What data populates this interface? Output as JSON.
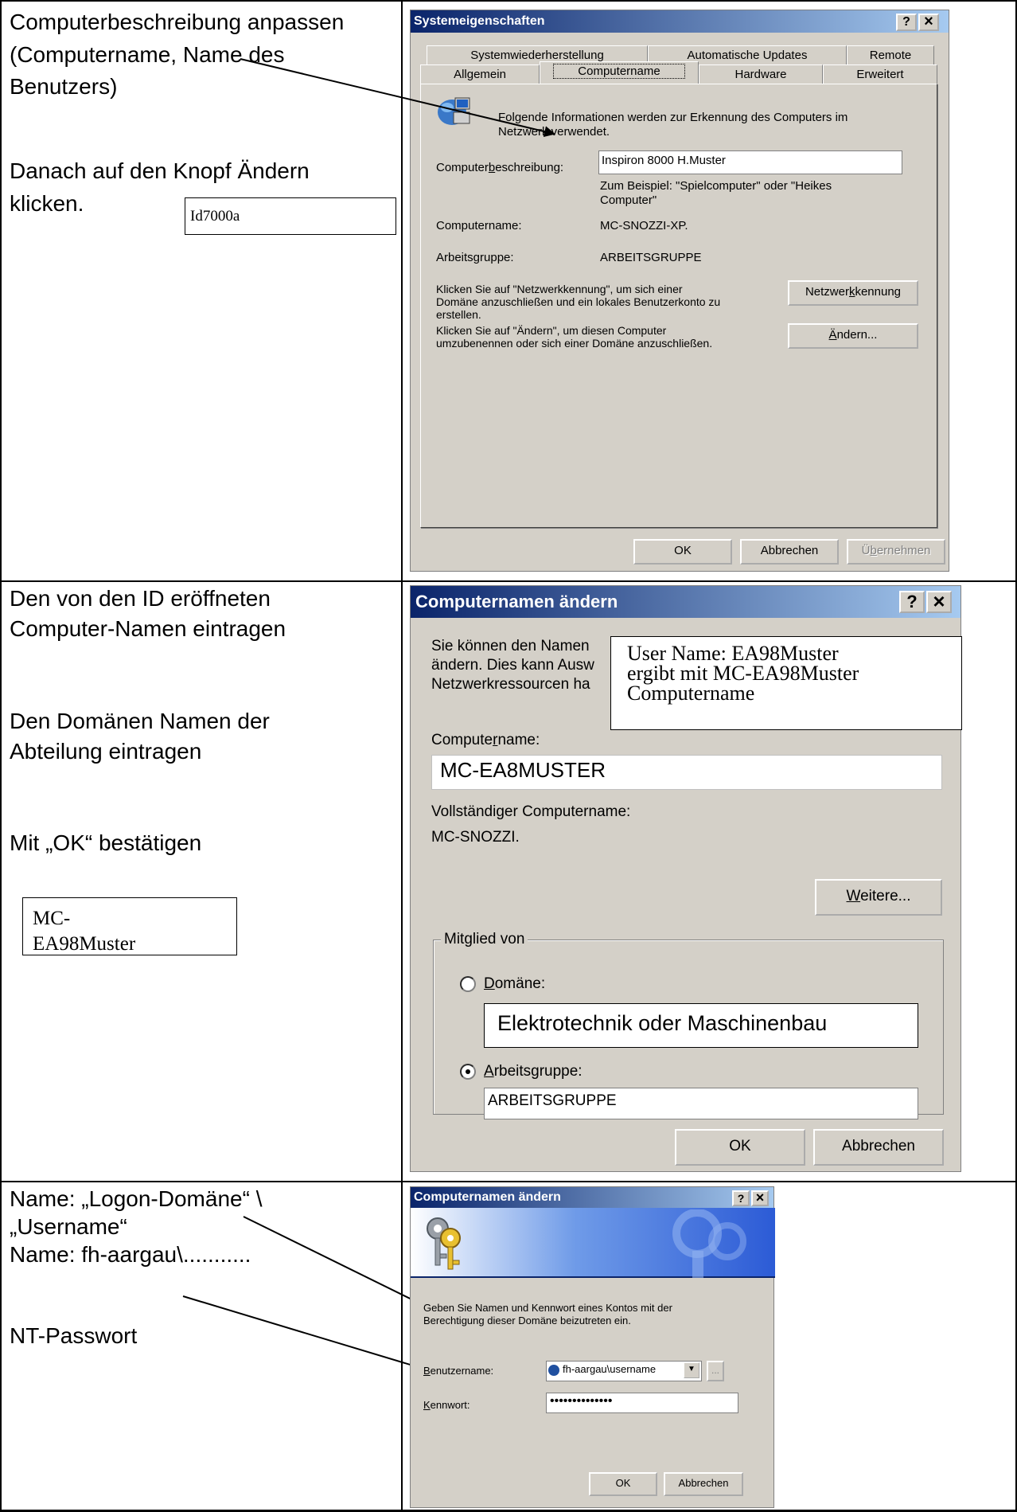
{
  "left_column": {
    "row1": {
      "line1": "Computerbeschreibung anpassen",
      "line2": "(Computername, Name des",
      "line3": "Benutzers)",
      "line4": "Danach auf den Knopf Ändern",
      "line5": "klicken.",
      "box_text": "Id7000a"
    },
    "row2": {
      "line1": "Den von den ID eröffneten",
      "line2": "Computer-Namen eintragen",
      "line3": "Den Domänen Namen der",
      "line4": "Abteilung eintragen",
      "line5": "Mit „OK“ bestätigen",
      "box_line1": "MC-",
      "box_line2": "EA98Muster"
    },
    "row3": {
      "line1": "Name: „Logon-Domäne“ \\",
      "line2": "„Username“",
      "line3": "Name: fh-aargau\\...........",
      "line4": "NT-Passwort"
    }
  },
  "dialog1": {
    "title": "Systemeigenschaften",
    "help": "?",
    "close": "×",
    "tabs_back": [
      "Systemwiederherstellung",
      "Automatische Updates",
      "Remote"
    ],
    "tabs_front": [
      "Allgemein",
      "Computername",
      "Hardware",
      "Erweitert"
    ],
    "info_line1": "Folgende Informationen werden zur Erkennung des Computers im",
    "info_line2": "Netzwerk verwendet.",
    "desc_label": "Computerbeschreibung:",
    "desc_value": "Inspiron 8000 H.Muster",
    "example_line1": "Zum Beispiel: \"Spielcomputer\" oder \"Heikes",
    "example_line2": "Computer\"",
    "name_label": "Computername:",
    "name_value": "MC-SNOZZI-XP.",
    "group_label": "Arbeitsgruppe:",
    "group_value": "ARBEITSGRUPPE",
    "netid_text1": "Klicken Sie auf \"Netzwerkkennung\", um sich einer",
    "netid_text2": "Domäne anzuschließen und ein lokales Benutzerkonto zu",
    "netid_text3": "erstellen.",
    "netid_button": "Netzwerkkennung",
    "change_text1": "Klicken Sie auf \"Ändern\", um diesen Computer",
    "change_text2": "umzubenennen oder sich einer Domäne anzuschließen.",
    "change_button": "Ändern...",
    "ok": "OK",
    "cancel": "Abbrechen",
    "apply": "Übernehmen"
  },
  "dialog2": {
    "title": "Computernamen ändern",
    "help": "?",
    "close": "×",
    "intro1": "Sie können den Namen",
    "intro2": "ändern. Dies kann Ausw",
    "intro3": "Netzwerkressourcen ha",
    "note_line1": "User Name: EA98Muster",
    "note_line2": "ergibt  mit MC-EA98Muster",
    "note_line3": "Computername",
    "name_label": "Computername:",
    "name_value": "MC-EA8MUSTER",
    "full_label": "Vollständiger Computername:",
    "full_value": "MC-SNOZZI.",
    "more_button": "Weitere...",
    "member_legend": "Mitglied von",
    "domain_label": "Domäne:",
    "domain_value": "Elektrotechnik oder Maschinenbau",
    "workgroup_label": "Arbeitsgruppe:",
    "workgroup_value": "ARBEITSGRUPPE",
    "ok": "OK",
    "cancel": "Abbrechen"
  },
  "dialog3": {
    "title": "Computernamen ändern",
    "help": "?",
    "close": "×",
    "prompt1": "Geben Sie Namen und Kennwort eines Kontos mit der",
    "prompt2": "Berechtigung dieser Domäne beizutreten ein.",
    "user_label": "Benutzername:",
    "user_value": "fh-aargau\\username",
    "pass_label": "Kennwort:",
    "pass_value": "••••••••••••••",
    "browse": "...",
    "ok": "OK",
    "cancel": "Abbrechen"
  }
}
